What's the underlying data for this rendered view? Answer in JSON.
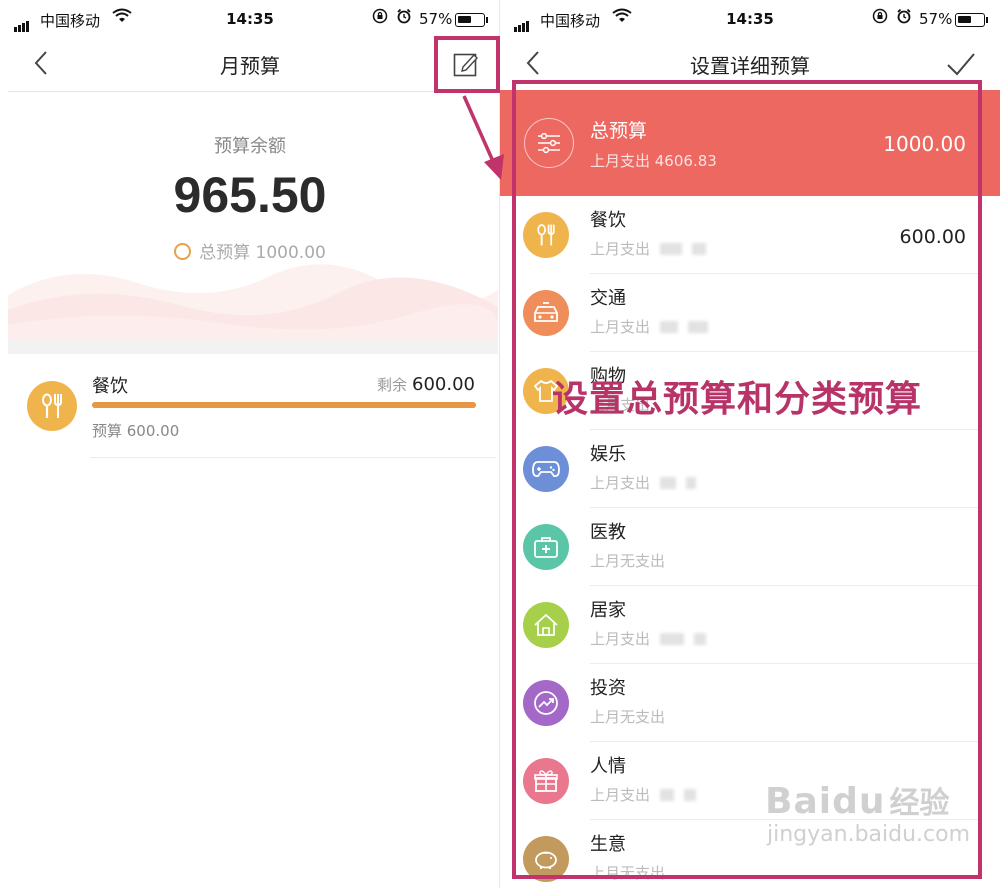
{
  "status_bar": {
    "carrier": "中国移动",
    "time": "14:35",
    "battery_percent": "57%",
    "battery_level": 0.57
  },
  "left_screen": {
    "title": "月预算",
    "back_icon": "chevron-left-icon",
    "edit_icon": "edit-icon",
    "balance_label": "预算余额",
    "balance_value": "965.50",
    "total_budget": "总预算 1000.00",
    "category": {
      "name": "餐饮",
      "remaining_label": "剩余",
      "remaining_value": "600.00",
      "budget_text": "预算 600.00",
      "progress": 1.0,
      "icon": "fork-spoon-icon",
      "color": "#f0b44c"
    }
  },
  "right_screen": {
    "title": "设置详细预算",
    "back_icon": "chevron-left-icon",
    "confirm_icon": "checkmark-icon",
    "total": {
      "name": "总预算",
      "sub": "上月支出 4606.83",
      "value": "1000.00",
      "icon": "sliders-icon",
      "color": "#ec6861"
    },
    "rows": [
      {
        "name": "餐饮",
        "sub": "上月支出",
        "value": "600.00",
        "icon": "fork-spoon-icon",
        "color": "#f0b44c"
      },
      {
        "name": "交通",
        "sub": "上月支出",
        "value": "",
        "icon": "car-icon",
        "color": "#ef8e5a"
      },
      {
        "name": "购物",
        "sub": "上月支出",
        "value": "",
        "icon": "shirt-icon",
        "color": "#f0b44c"
      },
      {
        "name": "娱乐",
        "sub": "上月支出",
        "value": "",
        "icon": "gamepad-icon",
        "color": "#6c8fd8"
      },
      {
        "name": "医教",
        "sub": "上月无支出",
        "value": "",
        "icon": "medkit-icon",
        "color": "#5bc6a7"
      },
      {
        "name": "居家",
        "sub": "上月支出",
        "value": "",
        "icon": "house-icon",
        "color": "#a6cf4a"
      },
      {
        "name": "投资",
        "sub": "上月无支出",
        "value": "",
        "icon": "trend-icon",
        "color": "#a468c8"
      },
      {
        "name": "人情",
        "sub": "上月支出",
        "value": "",
        "icon": "gift-icon",
        "color": "#e9778d"
      },
      {
        "name": "生意",
        "sub": "上月无支出",
        "value": "",
        "icon": "piggy-icon",
        "color": "#c39a5e"
      }
    ]
  },
  "annotation": {
    "caption": "设置总预算和分类预算",
    "highlight_color": "#c0336b"
  },
  "watermark": {
    "brand": "Baidu",
    "jingyan": "经验",
    "url": "jingyan.baidu.com"
  }
}
